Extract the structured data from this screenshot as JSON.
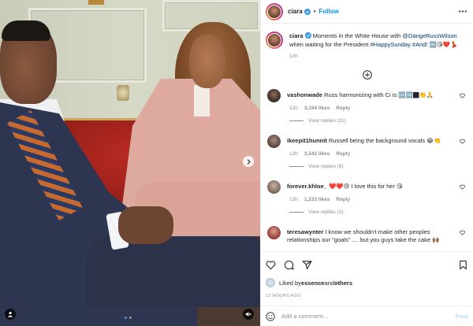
{
  "header": {
    "username": "ciara",
    "separator": "•",
    "follow_label": "Follow"
  },
  "caption": {
    "username": "ciara",
    "text_before": " Moments in the White House with ",
    "mention": "@DangeRussWilson",
    "text_middle": " when waiting for the President ",
    "hashtags": "#HappySunday #And!",
    "emoji": " 🆒😘❤️💃",
    "time": "13h"
  },
  "comments": [
    {
      "username": "vashonwade",
      "text": "Russ harmonizing with Ci is 🆒🆒🏿👏🙏",
      "time": "13h",
      "likes": "3,194 likes",
      "reply_label": "Reply",
      "view_replies": "View replies (11)"
    },
    {
      "username": "ikeepit1hunnit",
      "text": "Russell being the background vocals 😂👏",
      "time": "13h",
      "likes": "3,542 likes",
      "reply_label": "Reply",
      "view_replies": "View replies (8)"
    },
    {
      "username": "forever.khloe_",
      "text": "❤️❤️😢 I love this for her 😘",
      "time": "13h",
      "likes": "1,233 likes",
      "reply_label": "Reply",
      "view_replies": "View replies (3)"
    },
    {
      "username": "teresawynter",
      "text": "I know we shouldn't make other peoples relationships our \"goals\" .... but you guys take the cake 🙌🏾"
    }
  ],
  "likes": {
    "prefix": "Liked by ",
    "user": "essence",
    "and": " and ",
    "others": "others"
  },
  "time_ago": "13 HOURS AGO",
  "add_comment": {
    "placeholder": "Add a comment…",
    "post_label": "Post"
  },
  "colors": {
    "link_blue": "#0095f6",
    "muted": "#8e8e8e",
    "post_disabled": "#b2dffc"
  }
}
